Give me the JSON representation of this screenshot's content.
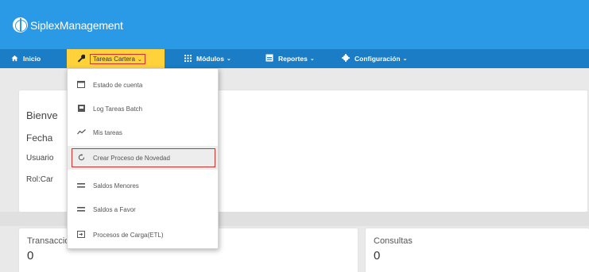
{
  "app": {
    "title": "SiplexManagement"
  },
  "nav": [
    {
      "label": "Inicio",
      "icon": "home-icon"
    },
    {
      "label": "Tareas Cartera",
      "icon": "wrench-icon",
      "active": true
    },
    {
      "label": "Módulos",
      "icon": "grid-icon"
    },
    {
      "label": "Reportes",
      "icon": "report-icon"
    },
    {
      "label": "Configuración",
      "icon": "gear-icon"
    }
  ],
  "dropdown": {
    "items": [
      {
        "label": "Estado de cuenta",
        "icon": "calendar-icon"
      },
      {
        "label": "Log Tareas Batch",
        "icon": "square-icon"
      },
      {
        "label": "Mis tareas",
        "icon": "trend-icon"
      },
      {
        "label": "Crear Proceso de Novedad",
        "icon": "refresh-icon",
        "selected": true
      },
      {
        "label": "Saldos Menores",
        "icon": "equals-icon"
      },
      {
        "label": "Saldos a Favor",
        "icon": "equals-icon"
      },
      {
        "label": "Procesos de Carga(ETL)",
        "icon": "import-icon"
      }
    ]
  },
  "welcome": {
    "title": "Bienve",
    "line1": "Fecha",
    "line2": "Usuario",
    "line3": "Rol:Car"
  },
  "cards": {
    "transacciones": {
      "label": "Transacciones",
      "value": "0"
    },
    "consultas": {
      "label": "Consultas",
      "value": "0"
    }
  },
  "colors": {
    "header": "#2b9ae6",
    "nav": "#1a7dc6",
    "active": "#ffd23c",
    "highlight": "#d3312a"
  }
}
